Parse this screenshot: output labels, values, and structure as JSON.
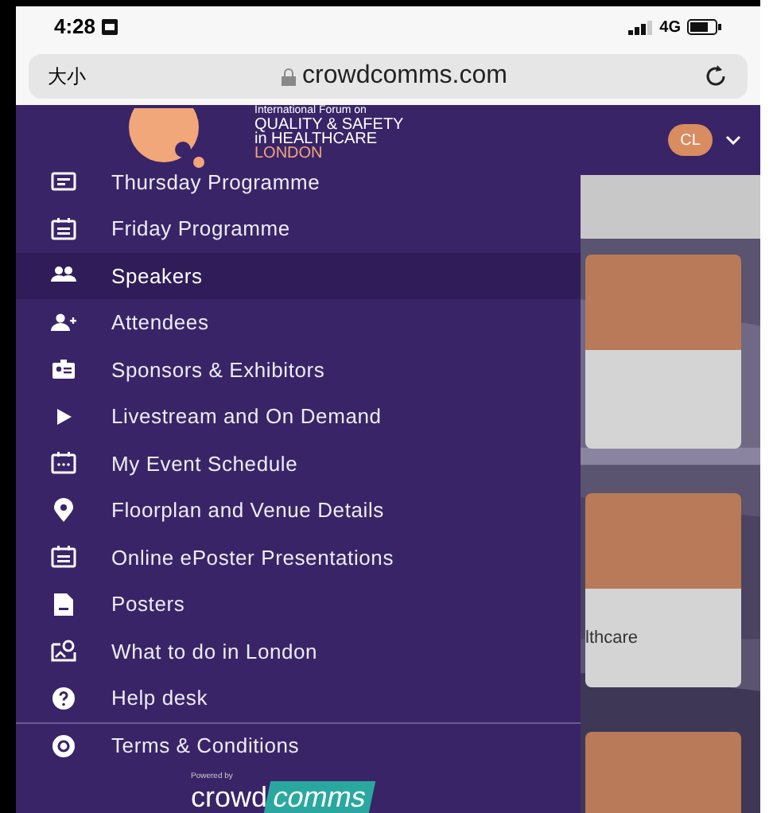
{
  "status_bar": {
    "time": "4:28",
    "network": "4G"
  },
  "browser": {
    "text_size": "大小",
    "url": "crowdcomms.com"
  },
  "header": {
    "brand_lines": [
      "International Forum on",
      "QUALITY & SAFETY",
      "in HEALTHCARE",
      "LONDON"
    ],
    "avatar": "CL"
  },
  "menu": [
    {
      "label": "Thursday Programme",
      "selected": false
    },
    {
      "label": "Friday Programme",
      "selected": false
    },
    {
      "label": "Speakers",
      "selected": true
    },
    {
      "label": "Attendees",
      "selected": false
    },
    {
      "label": "Sponsors & Exhibitors",
      "selected": false
    },
    {
      "label": "Livestream and On Demand",
      "selected": false
    },
    {
      "label": "My Event Schedule",
      "selected": false
    },
    {
      "label": "Floorplan and Venue Details",
      "selected": false
    },
    {
      "label": "Online ePoster Presentations",
      "selected": false
    },
    {
      "label": "Posters",
      "selected": false
    },
    {
      "label": "What to do in London",
      "selected": false
    },
    {
      "label": "Help desk",
      "selected": false
    },
    {
      "label": "Terms & Conditions",
      "selected": false
    }
  ],
  "footer": {
    "powered_by": "Powered by",
    "brand_left": "crowd",
    "brand_right": "comms"
  },
  "background_card_text": "lthcare"
}
